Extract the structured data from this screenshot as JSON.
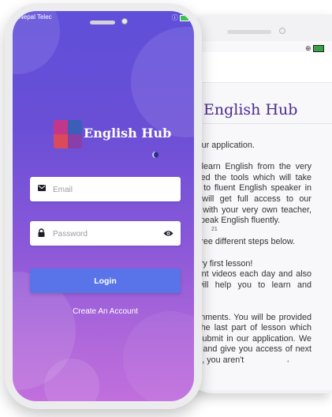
{
  "back_screen": {
    "title": "English Hub",
    "body": "Thank you for downloading our application.\n\nThrough this app you can learn English from the very beginning! We have designed the tools which will take you from absolute beginner to fluent English speaker in no time. In addition, you will get full access to our complete learning materials with your very own teacher, and be on the right track to speak English fluently.\n\nWe will be teaching that in three different steps below.\n\n1. Start the progress from very first lesson!\n     We will send you different videos each day and also reading materials which will help you to learn and understand with ease.\n\n2. Complete the given assignments. You will be provided with some assignments in the last part of lesson which you need to complete and submit in our application. We will check your assignments and give you access of next lesson with remarks.  In case, you aren't",
    "marker": "21",
    "marker2": "*"
  },
  "status_bar": {
    "carrier": "Nepal Telec",
    "icons": "ⓘ"
  },
  "brand": {
    "name": "English Hub"
  },
  "form": {
    "email_placeholder": "Email",
    "password_placeholder": "Password",
    "login_label": "Login",
    "create_account": "Create An Account"
  },
  "colors": {
    "gradient_top": "#5f4fd9",
    "gradient_bottom": "#c16fdd",
    "button": "#5874e8",
    "title_purple": "#4a2a8c"
  },
  "icons": [
    "email-icon",
    "lock-icon",
    "eye-icon",
    "app-logo",
    "camera-icon",
    "battery-icon"
  ]
}
